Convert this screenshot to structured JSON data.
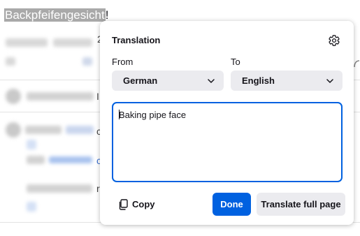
{
  "page": {
    "headline_selected": "Backpfeifengesicht",
    "headline_tail": "!",
    "background_glyphs": [
      "2",
      "I",
      "c",
      "c",
      "r"
    ]
  },
  "popup": {
    "title": "Translation",
    "settings_icon": "gear-icon",
    "from_label": "From",
    "to_label": "To",
    "from_value": "German",
    "to_value": "English",
    "translation_text": "Baking pipe face",
    "copy_label": "Copy",
    "copy_icon": "copy-icon",
    "done_label": "Done",
    "full_page_label": "Translate full page"
  },
  "colors": {
    "accent": "#0061e0",
    "button_gray": "#ebebef",
    "selection": "#a9a9a9"
  }
}
